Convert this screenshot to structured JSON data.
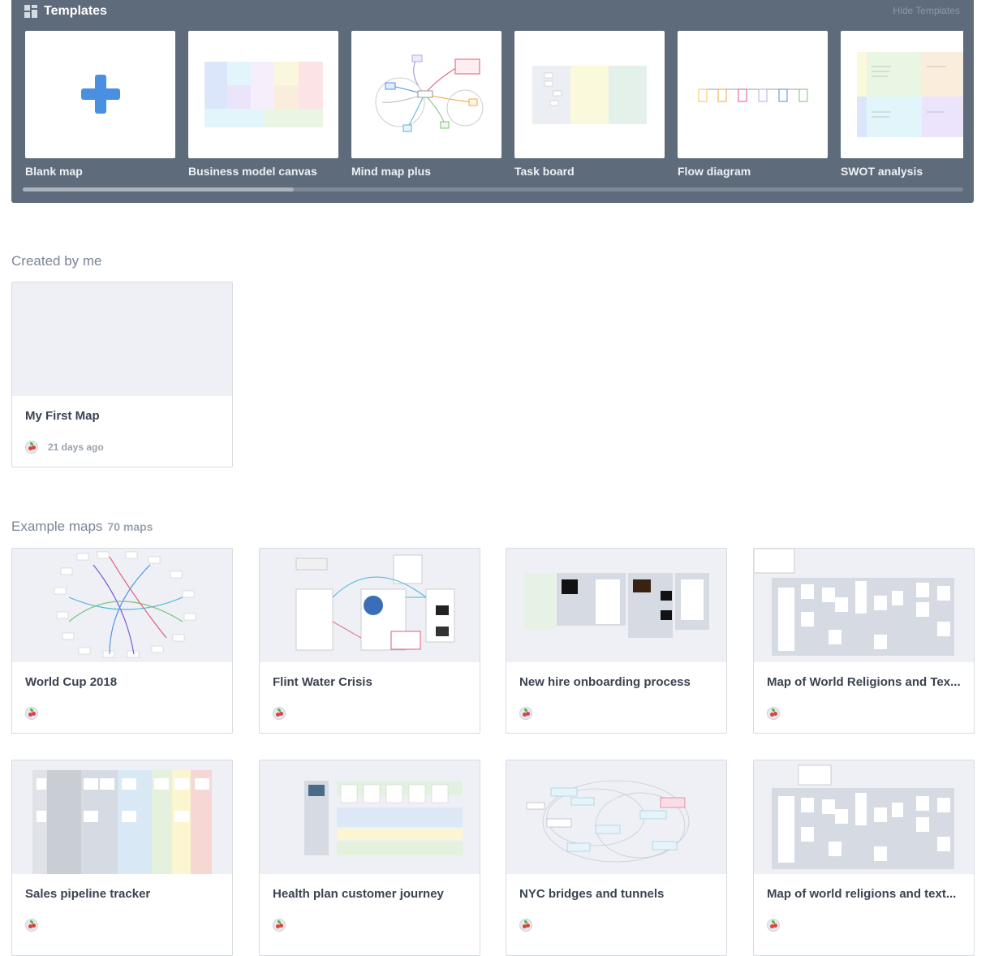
{
  "templates": {
    "title": "Templates",
    "hide_label": "Hide Templates",
    "items": [
      {
        "label": "Blank map"
      },
      {
        "label": "Business model canvas"
      },
      {
        "label": "Mind map plus"
      },
      {
        "label": "Task board"
      },
      {
        "label": "Flow diagram"
      },
      {
        "label": "SWOT analysis"
      }
    ]
  },
  "created": {
    "title": "Created by me",
    "items": [
      {
        "title": "My First Map",
        "time": "21 days ago"
      }
    ]
  },
  "examples": {
    "title": "Example maps",
    "count": "70 maps",
    "items": [
      {
        "title": "World Cup 2018"
      },
      {
        "title": "Flint Water Crisis"
      },
      {
        "title": "New hire onboarding process"
      },
      {
        "title": "Map of World Religions and Tex..."
      },
      {
        "title": "Sales pipeline tracker"
      },
      {
        "title": "Health plan customer journey"
      },
      {
        "title": "NYC bridges and tunnels"
      },
      {
        "title": "Map of world religions and text..."
      }
    ]
  },
  "colors": {
    "panel": "#5e6b7b",
    "plus": "#4a90e2",
    "card_border": "#d6dbe1",
    "thumb_bg": "#eef0f6"
  }
}
